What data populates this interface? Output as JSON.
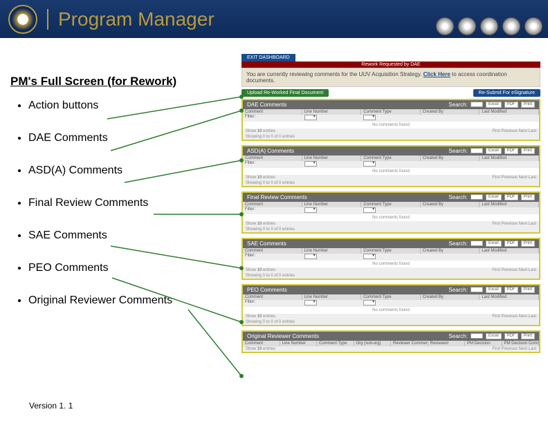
{
  "header": {
    "title": "Program Manager"
  },
  "subtitle": "PM's Full Screen (for Rework)",
  "bullets": [
    "Action buttons",
    "DAE Comments",
    "ASD(A) Comments",
    "Final Review Comments",
    "SAE Comments",
    "PEO Comments",
    "Original Reviewer Comments"
  ],
  "version": "Version 1. 1",
  "shot": {
    "tab": "EXIT DASHBOARD",
    "banner": "Rework Requested by DAE",
    "notice_pre": "You are currently reviewing comments for the UUV Acquisition Strategy. ",
    "notice_link": "Click Here",
    "notice_post": " to access coordination documents.",
    "btn_left": "Upload Re-Worked Final Document",
    "btn_right": "Re-Submit For eSignature",
    "search_label": "Search:",
    "tools": [
      "Excel",
      "PDF",
      "Print"
    ],
    "show_pre": "Show",
    "show_n": "10",
    "show_post": "entries",
    "showing": "Showing 0 to 0 of 0 entries",
    "nav": "First  Previous  Next  Last",
    "cols_std": [
      "Comment",
      "Line Number",
      "Comment Type",
      "Created By",
      "Last Modified"
    ],
    "cols_orig": [
      "Comment",
      "Line Number",
      "Comment Type",
      "Org (sub-org)",
      "Reviewer Comment",
      "Reviewed",
      "PM Decision",
      "PM Decision Comment"
    ],
    "filter_label": "Filter:",
    "nodata": "No comments found",
    "panels": [
      {
        "title": "DAE Comments"
      },
      {
        "title": "ASD(A) Comments"
      },
      {
        "title": "Final Review Comments"
      },
      {
        "title": "SAE Comments"
      },
      {
        "title": "PEO Comments"
      },
      {
        "title": "Original Reviewer Comments"
      }
    ]
  }
}
